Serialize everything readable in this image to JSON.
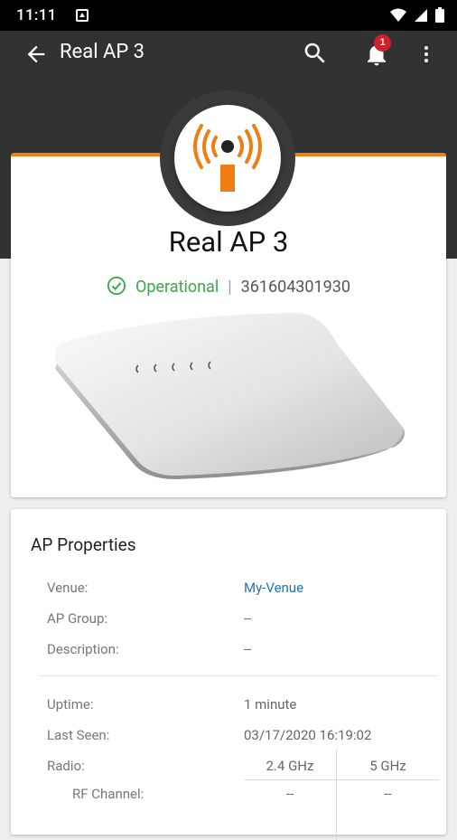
{
  "status_bar": {
    "time": "11:11"
  },
  "app_bar": {
    "title": "Real AP 3",
    "notification_count": "1"
  },
  "ap": {
    "name": "Real AP 3",
    "status": "Operational",
    "separator": "|",
    "serial": "361604301930",
    "status_color": "#3aa84a",
    "accent_color": "#ee7d12"
  },
  "properties": {
    "title": "AP Properties",
    "rows": [
      {
        "label": "Venue:",
        "value": "My-Venue"
      },
      {
        "label": "AP Group:",
        "value": "--"
      },
      {
        "label": "Description:",
        "value": "--"
      },
      {
        "label": "Uptime:",
        "value": "1 minute"
      },
      {
        "label": "Last Seen:",
        "value": "03/17/2020 16:19:02"
      }
    ],
    "radio": {
      "label": "Radio:",
      "bands": [
        "2.4 GHz",
        "5 GHz"
      ],
      "rf_channel_label": "RF Channel:",
      "rf_channel_values": [
        "--",
        "--"
      ]
    }
  }
}
